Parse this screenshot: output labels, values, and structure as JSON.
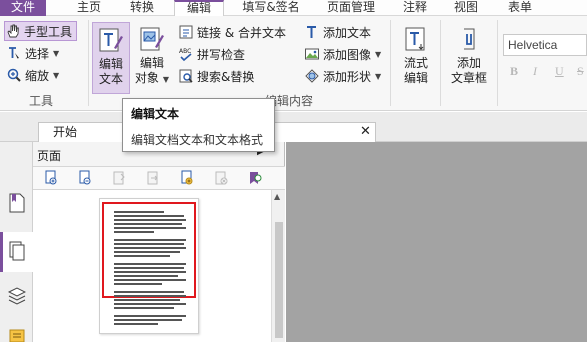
{
  "menu": {
    "items": [
      "文件",
      "主页",
      "转换",
      "编辑",
      "填写&签名",
      "页面管理",
      "注释",
      "视图",
      "表单"
    ],
    "active": "编辑",
    "accent_color": "#7b4f9d"
  },
  "ribbon": {
    "tools_group": {
      "hand_tool": "手型工具",
      "select": "选择",
      "zoom": "缩放",
      "label": "工具"
    },
    "edit_group": {
      "edit_text_line1": "编辑",
      "edit_text_line2": "文本",
      "edit_object_line1": "编辑",
      "edit_object_line2": "对象",
      "link_merge": "链接 & 合并文本",
      "spell_check": "拼写检查",
      "search_replace": "搜索&替换",
      "add_text": "添加文本",
      "add_image": "添加图像",
      "add_shape": "添加形状",
      "label": "编辑内容"
    },
    "flow_edit_line1": "流式",
    "flow_edit_line2": "编辑",
    "add_textbox_line1": "添加",
    "add_textbox_line2": "文章框",
    "font_name": "Helvetica",
    "format_buttons": [
      "B",
      "I",
      "U",
      "S"
    ]
  },
  "tooltip": {
    "title": "编辑文本",
    "body": "编辑文档文本和文本格式"
  },
  "tabs": {
    "start": "开始"
  },
  "panel": {
    "title": "页面"
  },
  "icons": [
    "hand-icon",
    "select-text-icon",
    "zoom-icon",
    "edit-text-icon",
    "edit-object-icon",
    "link-icon",
    "spellcheck-icon",
    "search-replace-icon",
    "add-text-icon",
    "add-image-icon",
    "add-shape-icon",
    "flow-edit-icon",
    "textbox-icon",
    "bookmark-icon",
    "pages-icon",
    "layers-icon",
    "comment-icon"
  ]
}
